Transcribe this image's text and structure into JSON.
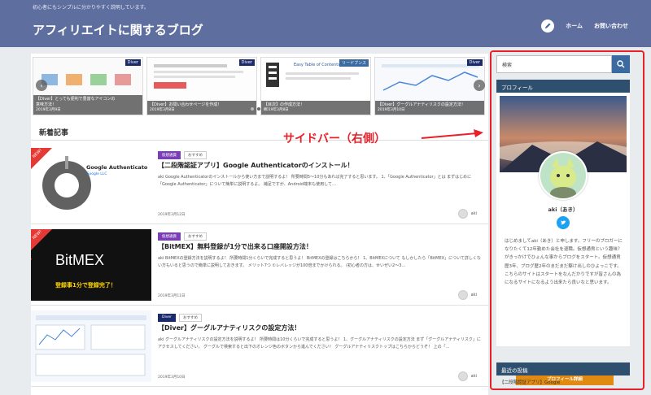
{
  "header": {
    "tagline": "初心者にもシンプルに分かりやすく説明しています。",
    "site_title": "アフィリエイトに関するブログ",
    "nav": [
      {
        "label": "ホーム"
      },
      {
        "label": "お問い合わせ"
      }
    ]
  },
  "slider": {
    "slides": [
      {
        "badge": "Diver",
        "title": "【Diver】とっても便利で豊富なアイコンの",
        "title2": "意味方法！",
        "date": "2019年3月9日"
      },
      {
        "badge": "Diver",
        "title": "【Diver】お問い合わせページを作成！",
        "title2": "",
        "date": "2019年3月8日"
      },
      {
        "badge": "リードブンス",
        "title": "【目次】の作成方法！",
        "title2": "",
        "date": "2019年3月8日",
        "toc_label": "Easy Table of Contents"
      },
      {
        "badge": "Diver",
        "title": "【Diver】グーグルアナティリスクの設定方法！",
        "title2": "",
        "date": "2019年3月10日"
      }
    ]
  },
  "section": {
    "title": "新着記事"
  },
  "posts": [
    {
      "category": "仮想通貨",
      "tag": "おすすめ",
      "title": "【二段階認証アプリ】Google Authenticatorのインストール！",
      "excerpt": "aki Google Authenticatorのインストールから使い方まで説明するよ！ 所要時間5〜10分もあれば完了すると思います。 1、「Google Authenticator」とは まずはじめに「Google Authenticator」について簡単に説明するよ。 補足ですが、Android端末も使用して…",
      "date": "2019年3月12日",
      "author": "aki",
      "thumb_title": "Google Authenticato",
      "thumb_sub": "Google LLC",
      "new_label": "NEW!"
    },
    {
      "category": "仮想通貨",
      "tag": "おすすめ",
      "title": "【BitMEX】無料登録が1分で出来る口座開設方法！",
      "excerpt": "aki BitMEXの登録方法を説明するよ！ 所要時間1分くらいで完成すると思うよ！ BitMEXの登録はこちらから！ 1、BitMEXについて もしかしたら「BitMEX」について詳しくない方もいると思うので簡単に説明しておきます。 メリット7つ ①レバレッジが100倍までかけられる。 (初心者の方は、せいぜい2〜3…",
      "date": "2019年3月11日",
      "author": "aki",
      "thumb_title": "BitMEX",
      "thumb_sub": "登録事1分で登録完了！",
      "new_label": "NEW!"
    },
    {
      "category": "Diver",
      "tag": "おすすめ",
      "title": "【Diver】グーグルアナティリスクの設定方法！",
      "excerpt": "aki グーグルアナティリスクの設定方法を説明するよ！ 所要時間は10分くらいで完成すると思うよ！ 1、グーグルアナティリスクの設定方法 まず「グーグルアナティリスク」にアクセスしてください。 グーグルで検索すると出下のオレンジ色のボタンから進んでください！ グーグルアナティリスクトップはこちらからどうぞ！ 上の「…",
      "date": "2019年3月10日",
      "author": "aki"
    }
  ],
  "annotation": {
    "text": "サイドバー（右側）"
  },
  "sidebar": {
    "search_placeholder": "検索",
    "profile_heading": "プロフィール",
    "profile_name": "aki（あき）",
    "profile_bio": "はじめましてaki（あき）と申します。フリーのブロガーになりたくて12年勤めた会社を退職。仮想通貨という趣味？がきっかけでひょんな事からブログをスタート。仮想通貨歴3年、ブログ歴2年のまだまだ駆け出しのひよっこです。こちらのサイトはスタートをなんだかりですが皆さんの為になるサイトになるよう出来たら良いなと思います。",
    "profile_button": "プロフィール詳細",
    "recent_heading": "最近の投稿",
    "recent_items": [
      {
        "label": "【二段階認証アプリ】Google"
      }
    ]
  },
  "colors": {
    "header_bg": "#5e6e9f",
    "widget_head": "#2f4f6f",
    "annotation": "#e8202a",
    "button": "#e08a12",
    "diver_badge": "#1b2a6b",
    "category": "#7a3fb5"
  }
}
